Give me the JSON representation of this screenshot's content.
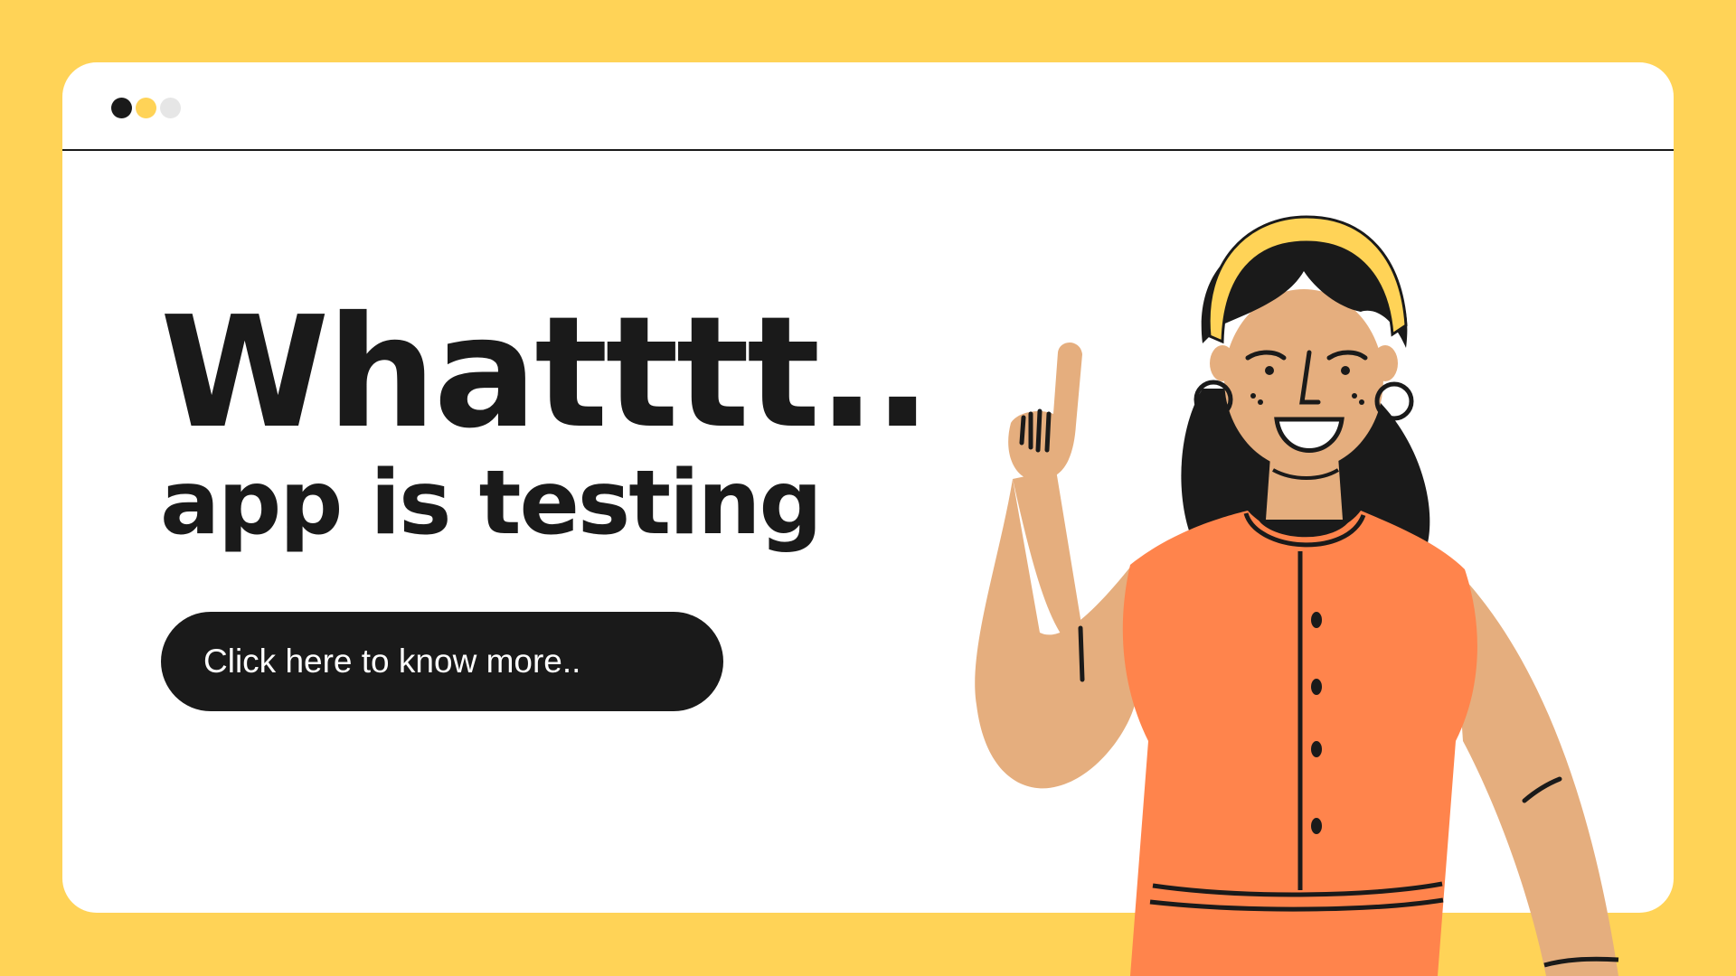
{
  "page": {
    "background_color": "#FFD357"
  },
  "window": {
    "background_color": "#FFFFFF",
    "controls": [
      {
        "name": "window-dot-dark",
        "color": "#1A1A1A"
      },
      {
        "name": "window-dot-yellow",
        "color": "#FFD357"
      },
      {
        "name": "window-dot-light",
        "color": "#E6E6E6"
      }
    ]
  },
  "hero": {
    "headline": "Whatttt..",
    "subheadline": "app is testing",
    "cta_label": "Click here to know more.."
  },
  "illustration": {
    "icon": "woman-pointing-up-illustration",
    "colors": {
      "skin": "#E5AE7E",
      "dress": "#FF844C",
      "hair": "#1A1A1A",
      "headband": "#FFD357"
    }
  }
}
